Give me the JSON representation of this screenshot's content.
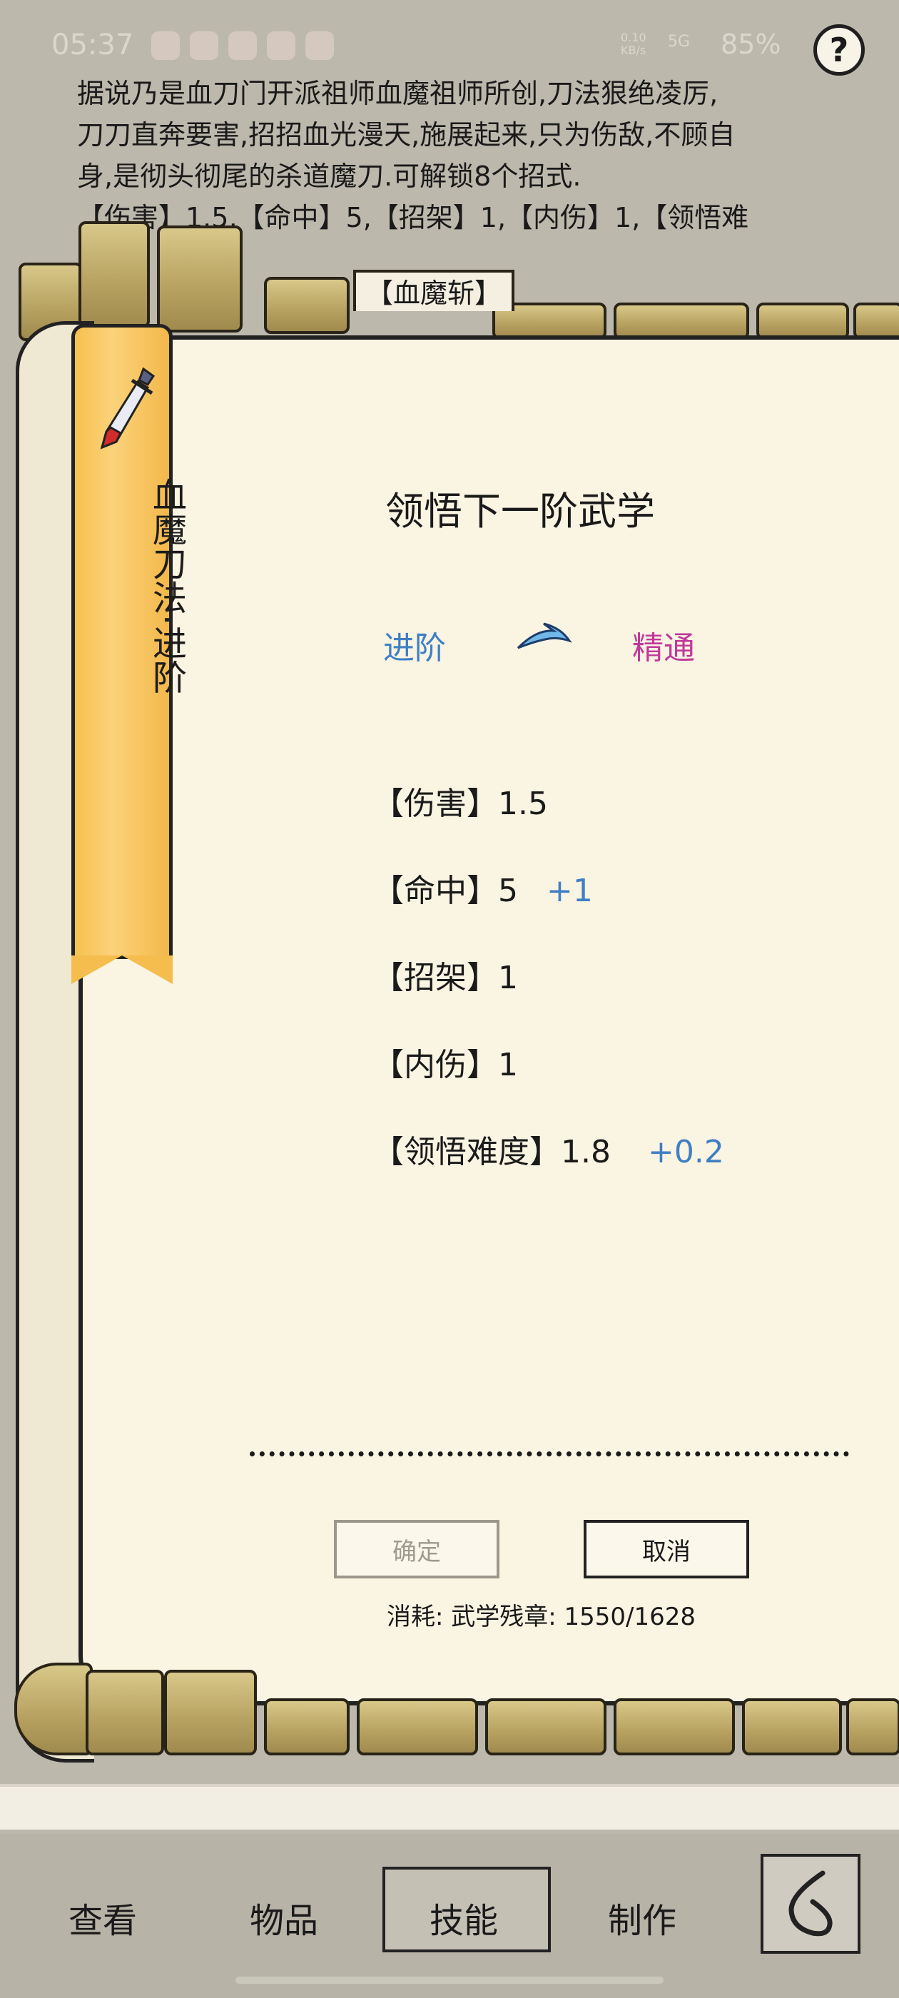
{
  "status": {
    "time": "05:37",
    "net_speed": "0.10",
    "net_unit": "KB/s",
    "signal": "5G",
    "battery": "85%"
  },
  "help": {
    "label": "?"
  },
  "description": {
    "lines": [
      "据说乃是血刀门开派祖师血魔祖师所创,刀法狠绝凌厉,",
      "刀刀直奔要害,招招血光漫天,施展起来,只为伤敌,不顾自",
      "身,是彻头彻尾的杀道魔刀.可解锁8个招式.",
      "【伤害】1.5,【命中】5,【招架】1,【内伤】1,【领悟难"
    ]
  },
  "scroll_tab": {
    "label": "【血魔斩】"
  },
  "ribbon": {
    "title": "血魔刀法·进阶",
    "icon": "dagger-icon"
  },
  "panel": {
    "title": "领悟下一阶武学",
    "from_tier": "进阶",
    "to_tier": "精通",
    "arrow_icon": "arrow-right-icon",
    "stats": [
      {
        "label": "【伤害】1.5",
        "bonus": ""
      },
      {
        "label": "【命中】5",
        "bonus": "+1"
      },
      {
        "label": "【招架】1",
        "bonus": ""
      },
      {
        "label": "【内伤】1",
        "bonus": ""
      },
      {
        "label": "【领悟难度】1.8",
        "bonus": "+0.2"
      }
    ],
    "confirm_label": "确定",
    "cancel_label": "取消",
    "cost": "消耗: 武学残章: 1550/1628"
  },
  "nav": {
    "items": [
      "查看",
      "物品",
      "技能",
      "制作"
    ],
    "active": "技能",
    "back_icon": "back-icon"
  },
  "colors": {
    "tier_from": "#3f7fc4",
    "tier_to": "#c0389a",
    "ribbon": "#f6c14e",
    "paper": "#faf4e3"
  }
}
